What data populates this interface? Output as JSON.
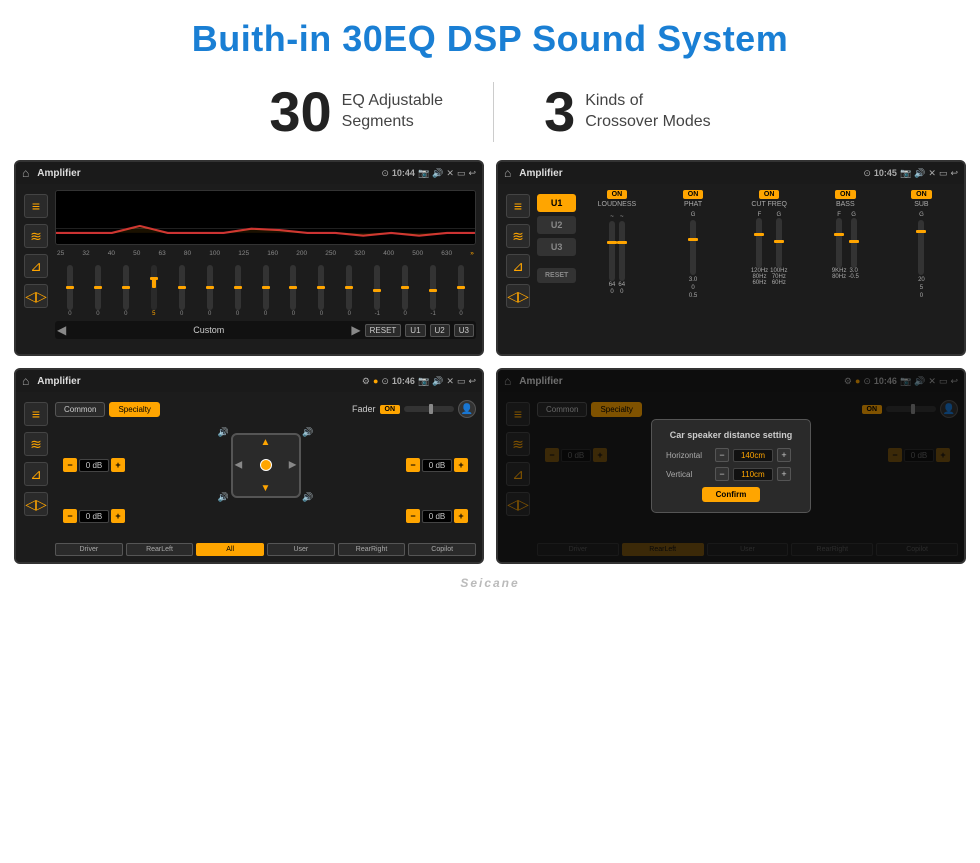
{
  "header": {
    "title": "Buith-in 30EQ DSP Sound System"
  },
  "stats": [
    {
      "number": "30",
      "text_line1": "EQ Adjustable",
      "text_line2": "Segments"
    },
    {
      "number": "3",
      "text_line1": "Kinds of",
      "text_line2": "Crossover Modes"
    }
  ],
  "screens": [
    {
      "id": "eq-screen",
      "statusbar": {
        "app": "Amplifier",
        "time": "10:44"
      },
      "type": "equalizer",
      "freqs": [
        "25",
        "32",
        "40",
        "50",
        "63",
        "80",
        "100",
        "125",
        "160",
        "200",
        "250",
        "320",
        "400",
        "500",
        "630"
      ],
      "eq_values": [
        0,
        0,
        0,
        5,
        0,
        0,
        0,
        0,
        0,
        0,
        0,
        -1,
        0,
        -1,
        0
      ],
      "bottom_label": "Custom",
      "presets": [
        "RESET",
        "U1",
        "U2",
        "U3"
      ]
    },
    {
      "id": "crossover-screen",
      "statusbar": {
        "app": "Amplifier",
        "time": "10:45"
      },
      "type": "crossover",
      "presets": [
        "U1",
        "U2",
        "U3"
      ],
      "params": [
        "LOUDNESS",
        "PHAT",
        "CUT FREQ",
        "BASS",
        "SUB"
      ],
      "param_values": [
        "64",
        "3.0",
        "100Hz",
        "3.0",
        "20"
      ],
      "reset_label": "RESET"
    },
    {
      "id": "fader-screen",
      "statusbar": {
        "app": "Amplifier",
        "time": "10:46"
      },
      "type": "fader",
      "tabs": [
        "Common",
        "Specialty"
      ],
      "active_tab": "Specialty",
      "fader_label": "Fader",
      "on_label": "ON",
      "speaker_dbs": [
        "0 dB",
        "0 dB",
        "0 dB",
        "0 dB"
      ],
      "bottom_btns": [
        "Driver",
        "RearLeft",
        "All",
        "User",
        "RearRight",
        "Copilot"
      ]
    },
    {
      "id": "distance-screen",
      "statusbar": {
        "app": "Amplifier",
        "time": "10:46"
      },
      "type": "distance",
      "tabs": [
        "Common",
        "Specialty"
      ],
      "active_tab": "Specialty",
      "dialog": {
        "title": "Car speaker distance setting",
        "rows": [
          {
            "label": "Horizontal",
            "value": "140cm"
          },
          {
            "label": "Vertical",
            "value": "110cm"
          }
        ],
        "confirm_label": "Confirm"
      },
      "speaker_dbs": [
        "0 dB",
        "0 dB"
      ],
      "bottom_btns": [
        "Driver",
        "RearLeft",
        "User",
        "RearRight",
        "Copilot"
      ]
    }
  ],
  "watermark": "Seicane"
}
